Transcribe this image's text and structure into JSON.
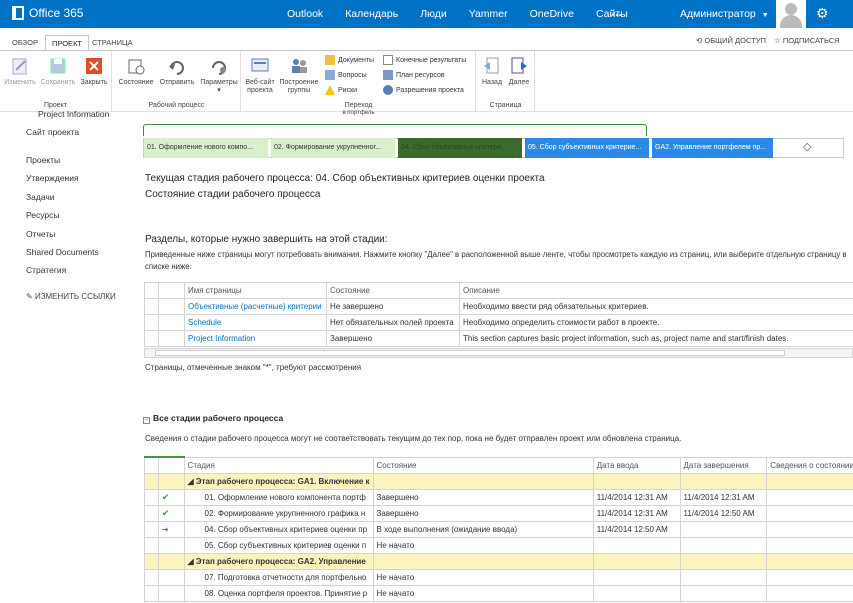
{
  "suite": {
    "brand": "Office 365",
    "nav": [
      "Outlook",
      "Календарь",
      "Люди",
      "Yammer",
      "OneDrive",
      "Сайты"
    ],
    "more": "...",
    "user": "Администратор"
  },
  "tabs": [
    "ОБЗОР",
    "ПРОЕКТ",
    "СТРАНИЦА"
  ],
  "share": "ОБЩИЙ ДОСТУП",
  "follow": "ПОДПИСАТЬСЯ",
  "ribbon": {
    "project": {
      "label": "Проект",
      "buttons": [
        "Изменить",
        "Сохранить",
        "Закрыть"
      ]
    },
    "process": {
      "label": "Рабочий процесс",
      "buttons": [
        "Состояние",
        "Отправить",
        "Параметры"
      ]
    },
    "nav": {
      "label": "Переход",
      "sublabel": "в портфель",
      "btn1": "Веб-сайт проекта",
      "btn2": "Построение группы",
      "small1": [
        "Документы",
        "Вопросы",
        "Риски"
      ],
      "small2": [
        "Конечные результаты",
        "План ресурсов",
        "Разрешения проекта"
      ]
    },
    "page": {
      "label": "Страница",
      "buttons": [
        "Назад",
        "Далее"
      ]
    }
  },
  "left": {
    "top": "Project Information",
    "items": [
      "Сайт проекта",
      "Проекты",
      "Утверждения",
      "Задачи",
      "Ресурсы",
      "Отчеты",
      "Shared Documents",
      "Стратегия"
    ],
    "edit": "ИЗМЕНИТЬ ССЫЛКИ"
  },
  "stages": [
    "01. Оформление нового компо...",
    "02. Формирование укрупненног...",
    "04. Сбор объективных критери...",
    "05. Сбор субъективных критерие...",
    "GA2. Управление портфелем пр..."
  ],
  "current_stage": "Текущая стадия рабочего процесса: 04. Сбор объективных критериев оценки проекта",
  "stage_state": "Состояние стадии рабочего процесса",
  "sections_title": "Разделы, которые нужно завершить на этой стадии:",
  "sections_desc": "Приведенные ниже страницы могут потребовать внимания. Нажмите кнопку \"Далее\" в расположенной выше ленте, чтобы просмотреть каждую из страниц, или выберите отдельную страницу в списке ниже.",
  "pages_table": {
    "headers": [
      "Имя страницы",
      "Состояние",
      "Описание"
    ],
    "rows": [
      [
        "Объективные (расчетные) критерии",
        "Не завершено",
        "Необходимо ввести ряд обязательных критериев."
      ],
      [
        "Schedule",
        "Нет обязательных полей проекта",
        "Необходимо определить стоимости работ в проекте."
      ],
      [
        "Project Information",
        "Завершено",
        "This section captures basic project information, such as, project name and start/finish dates."
      ]
    ]
  },
  "note": "Страницы, отмеченные знаком \"*\", требуют рассмотрения",
  "all_stages": "Все стадии рабочего процесса",
  "all_note": "Сведения о стадии рабочего процесса могут не соответствовать текущим до тех пор, пока не будет отправлен проект или обновлена страница.",
  "stages_table": {
    "headers": [
      "Стадия",
      "Состояние",
      "Дата ввода",
      "Дата завершения",
      "Сведения о состоянии"
    ],
    "rows": [
      {
        "group": true,
        "stage": "Этап рабочего процесса: GA1. Включение к"
      },
      {
        "mark": "✔",
        "stage": "01. Оформление нового компонента портф",
        "state": "Завершено",
        "in": "11/4/2014 12:31 AM",
        "out": "11/4/2014 12:31 AM"
      },
      {
        "mark": "✔",
        "stage": "02. Формирование укрупненного графика н",
        "state": "Завершено",
        "in": "11/4/2014 12:31 AM",
        "out": "11/4/2014 12:50 AM"
      },
      {
        "mark": "➜",
        "stage": "04. Сбор объективных критериев оценки пр",
        "state": "В ходе выполнения (ожидание ввода)",
        "in": "11/4/2014 12:50 AM",
        "out": ""
      },
      {
        "mark": "",
        "stage": "05. Сбор субъективных критериев оценки п",
        "state": "Не начато",
        "in": "",
        "out": ""
      },
      {
        "group": true,
        "stage": "Этап рабочего процесса: GA2. Управление"
      },
      {
        "mark": "",
        "stage": "07. Подготовка отчетности для портфельно",
        "state": "Не начато",
        "in": "",
        "out": ""
      },
      {
        "mark": "",
        "stage": "08. Оценка портфеля проектов. Принятие р",
        "state": "Не начато",
        "in": "",
        "out": ""
      }
    ]
  }
}
